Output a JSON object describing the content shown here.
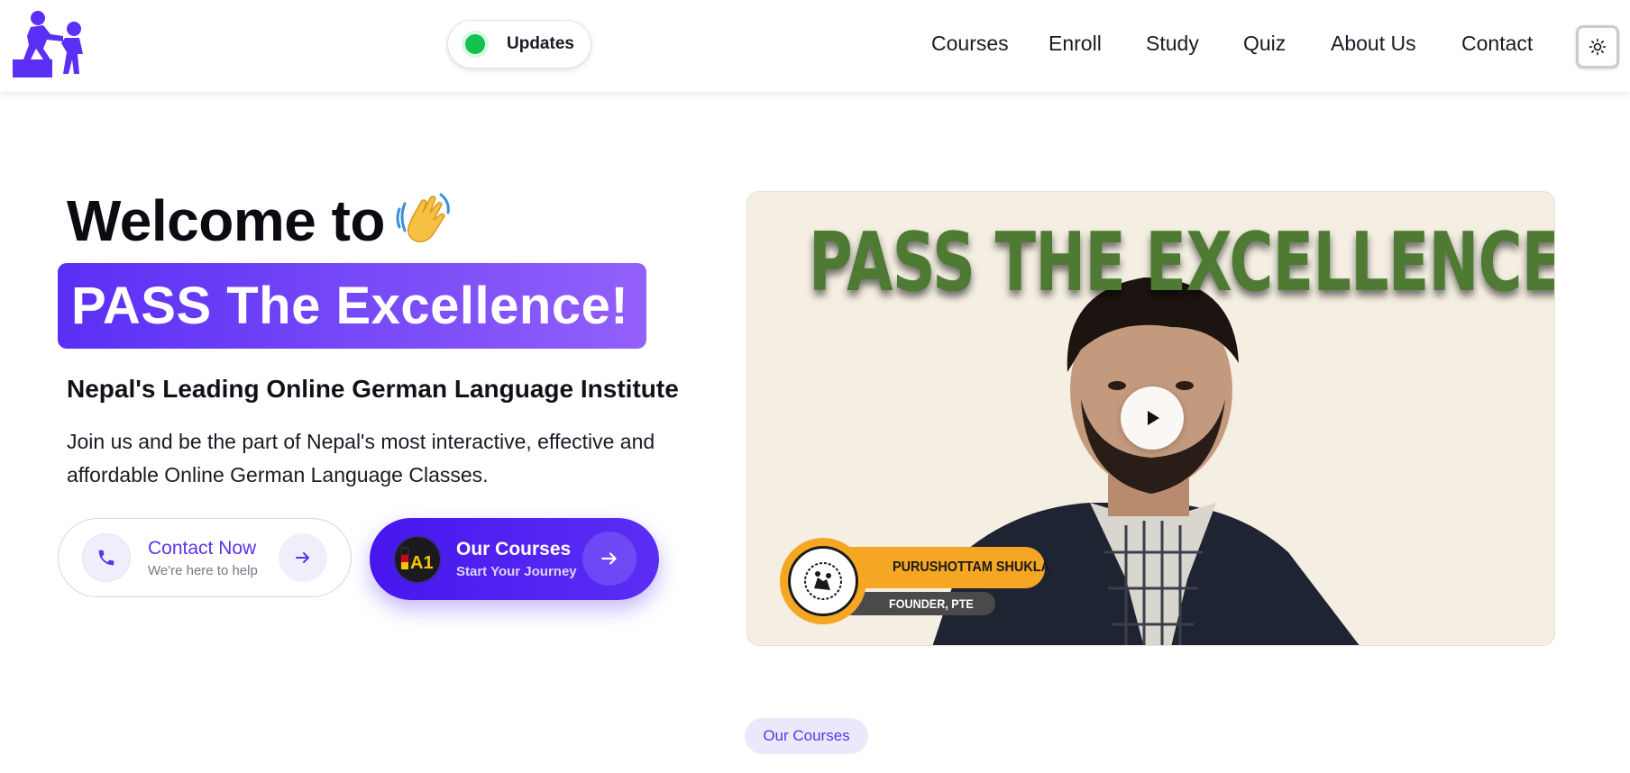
{
  "header": {
    "updates_label": "Updates",
    "nav": [
      "Courses",
      "Enroll",
      "Study",
      "Quiz",
      "About Us",
      "Contact"
    ],
    "theme_icon": "sun-icon",
    "logo_icon": "helping-hand-climb-icon",
    "status_color": "#13c24e",
    "brand_color": "#5b2ff5"
  },
  "hero": {
    "welcome": "Welcome to",
    "wave_icon": "waving-hand-emoji",
    "brand": "PASS The Excellence!",
    "subtitle": "Nepal's Leading Online German Language Institute",
    "description": "Join us and be the part of Nepal's most interactive, effective and affordable Online German Language Classes.",
    "contact_button": {
      "title": "Contact Now",
      "subtitle": "We're here to help",
      "icon": "phone-icon"
    },
    "courses_button": {
      "title": "Our Courses",
      "subtitle": "Start Your Journey",
      "badge": "A1"
    }
  },
  "video": {
    "title": "PASS THE EXCELLENCE",
    "name": "PURUSHOTTAM SHUKLA",
    "role": "FOUNDER, PTE",
    "play_icon": "play-icon",
    "title_color": "#4e7a34"
  },
  "section": {
    "pill": "Our Courses"
  }
}
